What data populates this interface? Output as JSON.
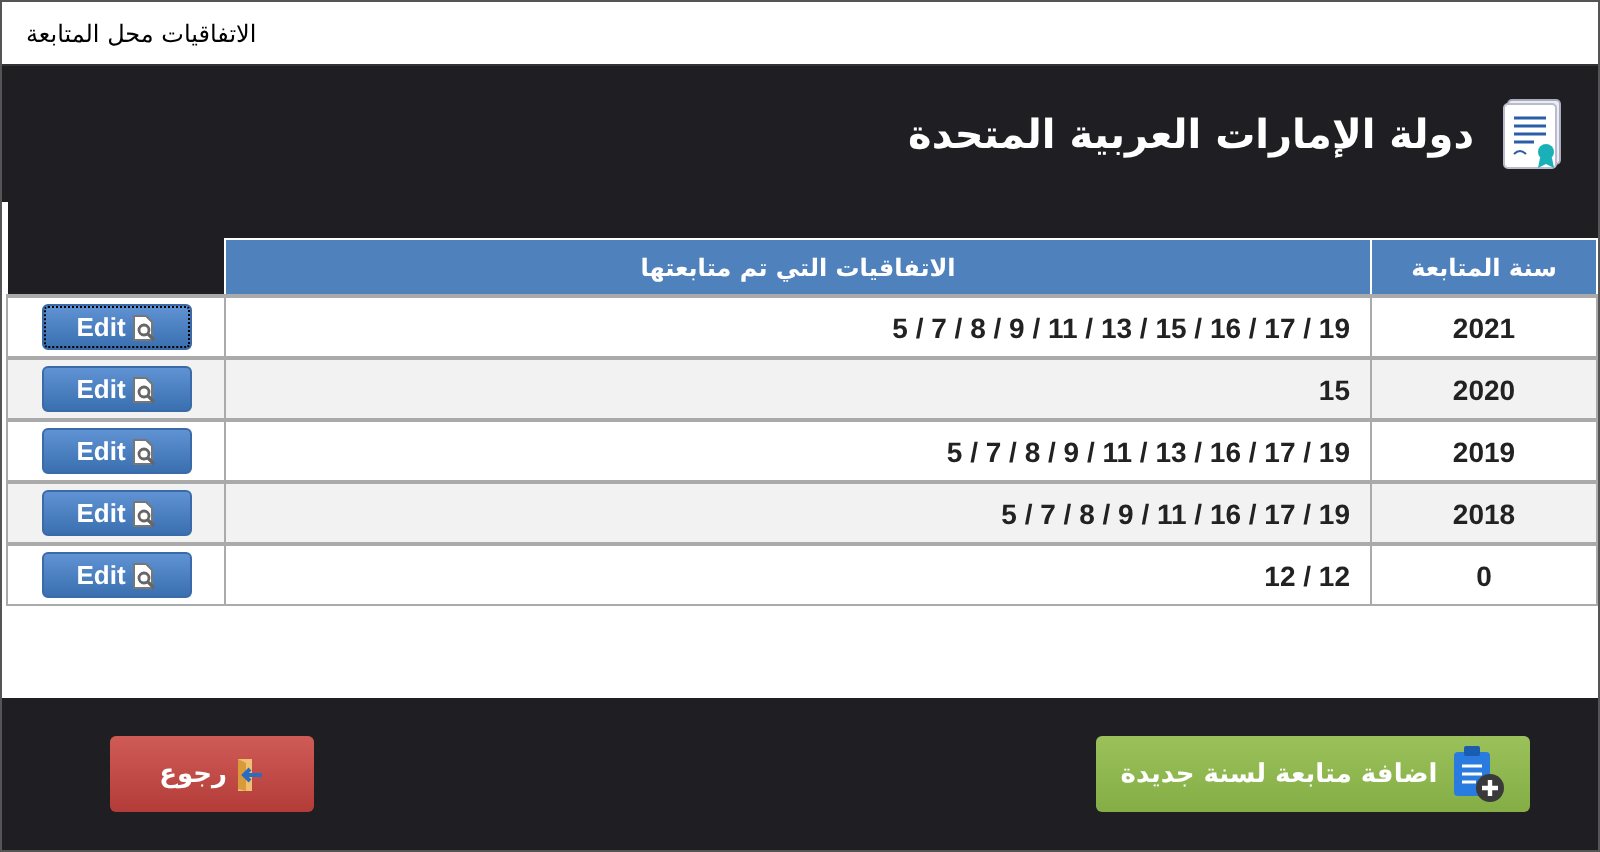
{
  "window": {
    "title": "الاتفاقيات محل المتابعة"
  },
  "header": {
    "title": "دولة الإمارات العربية المتحدة"
  },
  "table": {
    "columns": [
      "سنة المتابعة",
      "الاتفاقيات التي تم متابعتها"
    ],
    "rows": [
      {
        "year": "2021",
        "agreements": "5 / 7 / 8 / 9 / 11 / 13 / 15 / 16 / 17 / 19",
        "action": "Edit",
        "focused": true
      },
      {
        "year": "2020",
        "agreements": "15",
        "action": "Edit",
        "focused": false
      },
      {
        "year": "2019",
        "agreements": "5 / 7 / 8 / 9 / 11 / 13 / 16 / 17 / 19",
        "action": "Edit",
        "focused": false
      },
      {
        "year": "2018",
        "agreements": "5 / 7 / 8 / 9 / 11 / 16 / 17 / 19",
        "action": "Edit",
        "focused": false
      },
      {
        "year": "0",
        "agreements": "12 / 12",
        "action": "Edit",
        "focused": false
      }
    ]
  },
  "footer": {
    "add_button": "اضافة متابعة لسنة جديدة",
    "back_button": "رجوع"
  }
}
